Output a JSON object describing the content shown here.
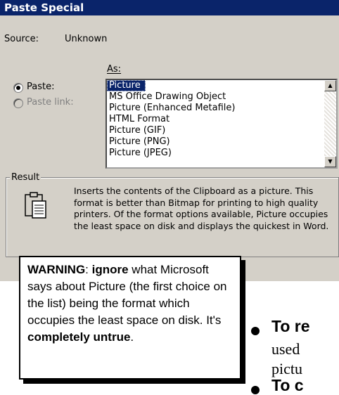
{
  "dialog": {
    "title": "Paste Special",
    "source_label": "Source:",
    "source_value": "Unknown",
    "as_label": "As:",
    "paste_label": "Paste:",
    "paste_link_label": "Paste link:",
    "list_items": [
      "Picture",
      "MS Office Drawing Object",
      "Picture (Enhanced Metafile)",
      "HTML Format",
      "Picture (GIF)",
      "Picture (PNG)",
      "Picture (JPEG)"
    ],
    "selected_item": "Picture",
    "result_label": "Result",
    "result_text": "Inserts the contents of the Clipboard as a picture. This format is better than Bitmap for printing to high quality printers. Of the format options available, Picture occupies the least space on disk and displays the quickest in Word."
  },
  "warning": {
    "w1": "WARNING",
    "w2": ": ",
    "w3": "ignore",
    "w4": " what Microsoft says about Picture (the first choice on the list) being the format which occupies the least space on disk. It's ",
    "w5": "completely untrue",
    "w6": "."
  },
  "page_text": {
    "bullet1_bold": "To re",
    "line2": "used",
    "line3": "pictu",
    "bullet2_bold": "To c"
  },
  "colors": {
    "titlebar": "#0a246a",
    "dialog_bg": "#d4d0c8",
    "selection": "#0a246a"
  }
}
